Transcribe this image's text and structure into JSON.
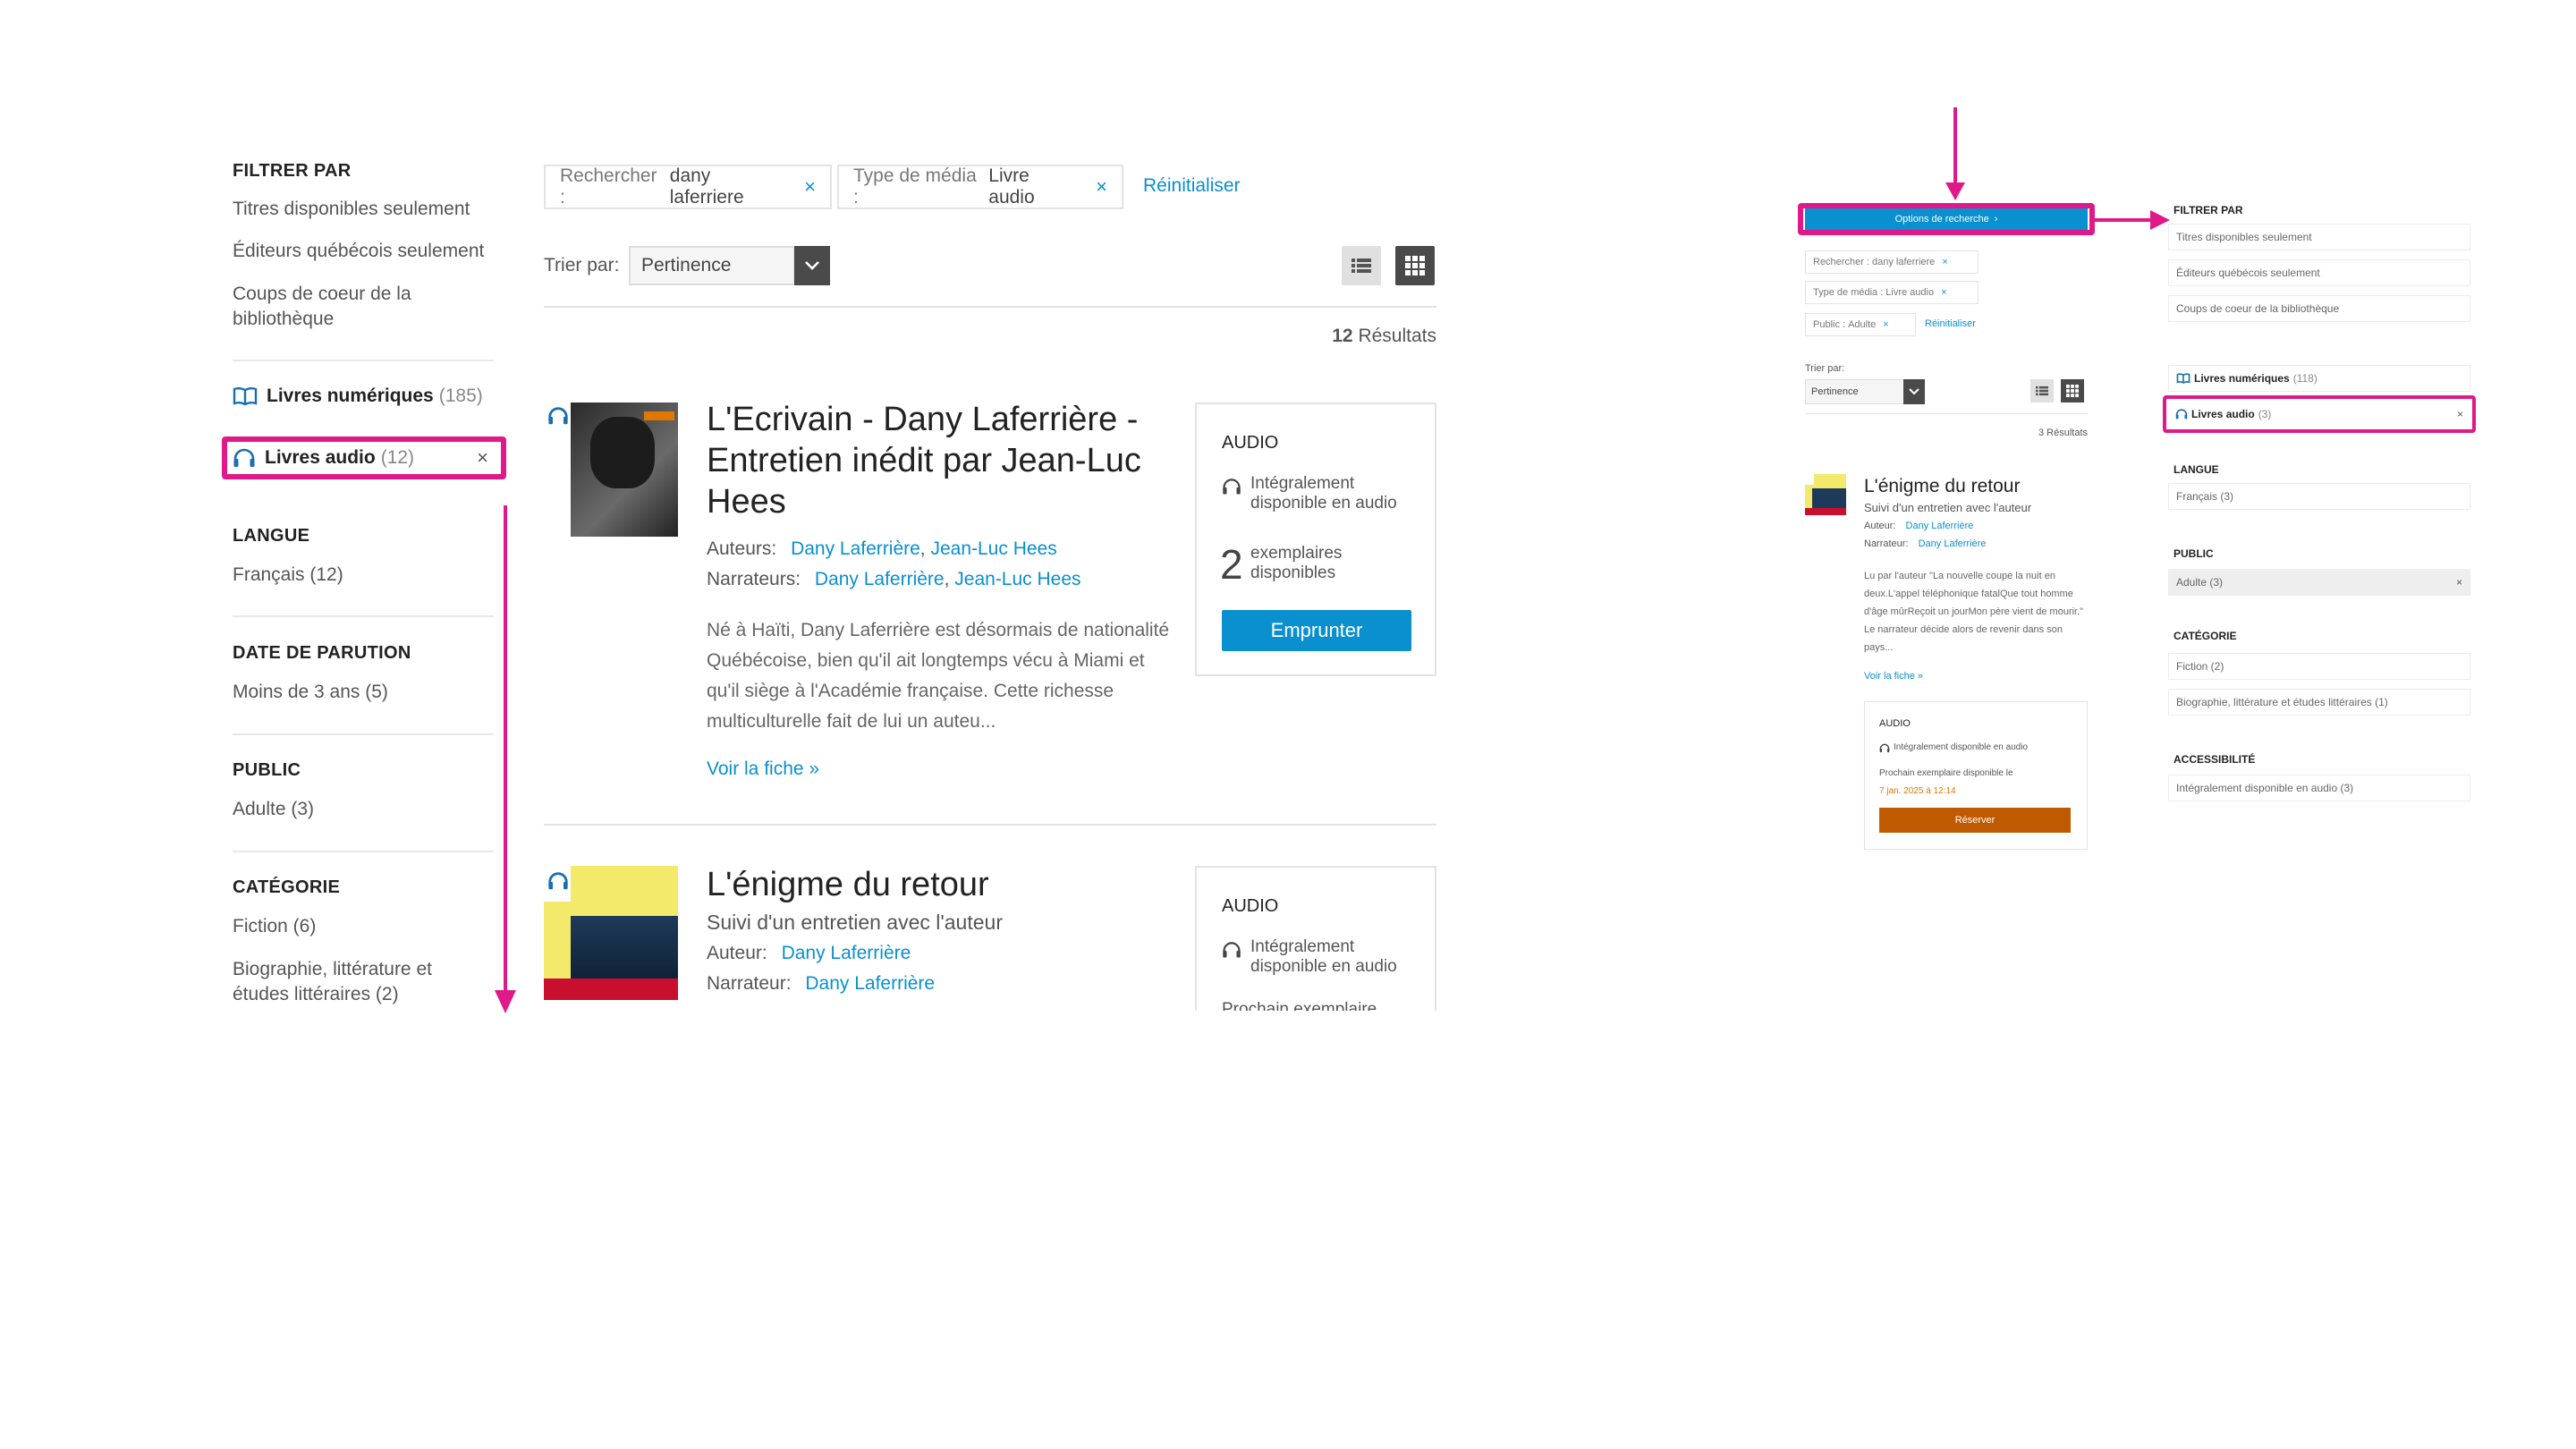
{
  "filters": {
    "heading": "FILTRER PAR",
    "quick": [
      "Titres disponibles seulement",
      "Éditeurs québécois seulement",
      "Coups de coeur de la bibliothèque"
    ],
    "media": [
      {
        "label": "Livres numériques",
        "count": "(185)",
        "icon": "open-book-icon"
      },
      {
        "label": "Livres audio",
        "count": "(12)",
        "icon": "headphones-icon",
        "remove": "×"
      }
    ],
    "langue": {
      "heading": "LANGUE",
      "items": [
        "Français (12)"
      ]
    },
    "date": {
      "heading": "DATE DE PARUTION",
      "items": [
        "Moins de 3 ans (5)"
      ]
    },
    "public": {
      "heading": "PUBLIC",
      "items": [
        "Adulte (3)"
      ]
    },
    "categorie": {
      "heading": "CATÉGORIE",
      "items": [
        "Fiction (6)",
        "Biographie, littérature et études littéraires (2)"
      ]
    }
  },
  "search": {
    "chips": [
      {
        "key": "Rechercher :",
        "value": "dany laferriere",
        "remove": "×"
      },
      {
        "key": "Type de média :",
        "value": "Livre audio",
        "remove": "×"
      }
    ],
    "reset": "Réinitialiser",
    "sort_label": "Trier par:",
    "sort_value": "Pertinence",
    "results_count": "12",
    "results_label": "Résultats"
  },
  "results": [
    {
      "title": "L'Ecrivain - Dany Laferrière - Entretien inédit par Jean-Luc Hees",
      "authors_label": "Auteurs:",
      "authors": [
        "Dany Laferrière",
        "Jean-Luc Hees"
      ],
      "narrators_label": "Narrateurs:",
      "narrators": [
        "Dany Laferrière",
        "Jean-Luc Hees"
      ],
      "description": "Né à Haïti, Dany Laferrière est désormais de nationalité Québécoise, bien qu'il ait longtemps vécu à Miami et qu'il siège à l'Académie française. Cette richesse multiculturelle fait de lui un auteu...",
      "more": "Voir la fiche »",
      "format": "AUDIO",
      "availability": "Intégralement disponible en audio",
      "copies_number": "2",
      "copies_label": "exemplaires disponibles",
      "action": "Emprunter"
    },
    {
      "title": "L'énigme du retour",
      "subtitle": "Suivi d'un entretien avec l'auteur",
      "authors_label": "Auteur:",
      "authors": [
        "Dany Laferrière"
      ],
      "narrators_label": "Narrateur:",
      "narrators": [
        "Dany Laferrière"
      ],
      "format": "AUDIO",
      "availability": "Intégralement disponible en audio",
      "next_copy": "Prochain exemplaire"
    }
  ],
  "mobile": {
    "options_button": "Options de recherche",
    "chips": [
      {
        "key": "Rechercher :",
        "value": "dany laferriere",
        "remove": "×"
      },
      {
        "key": "Type de média :",
        "value": "Livre audio",
        "remove": "×"
      },
      {
        "key": "Public :",
        "value": "Adulte",
        "remove": "×"
      }
    ],
    "reset": "Réinitialiser",
    "sort_label": "Trier par:",
    "sort_value": "Pertinence",
    "results": "3 Résultats",
    "book": {
      "title": "L'énigme du retour",
      "subtitle": "Suivi d'un entretien avec l'auteur",
      "author_label": "Auteur:",
      "author": "Dany Laferrière",
      "narrator_label": "Narrateur:",
      "narrator": "Dany Laferrière",
      "description": "Lu par l'auteur \"La nouvelle coupe la nuit en deux.L'appel téléphonique fatalQue tout homme d'âge mûrReçoit un jourMon père vient de mourir.\" Le narrateur décide alors de revenir dans son pays...",
      "more": "Voir la fiche »",
      "format": "AUDIO",
      "availability": "Intégralement disponible en audio",
      "next_label": "Prochain exemplaire disponible le",
      "next_date": "7 jan. 2025 à 12:14",
      "action": "Réserver"
    },
    "filters": {
      "heading": "FILTRER PAR",
      "quick": [
        "Titres disponibles seulement",
        "Éditeurs québécois seulement",
        "Coups de coeur de la bibliothèque"
      ],
      "media": [
        {
          "label": "Livres numériques",
          "count": "(118)"
        },
        {
          "label": "Livres audio",
          "count": "(3)",
          "remove": "×"
        }
      ],
      "langue": {
        "heading": "LANGUE",
        "item": "Français (3)"
      },
      "public": {
        "heading": "PUBLIC",
        "item": "Adulte (3)",
        "remove": "×"
      },
      "categorie": {
        "heading": "CATÉGORIE",
        "items": [
          "Fiction (2)",
          "Biographie, littérature et études littéraires (1)"
        ]
      },
      "accessibilite": {
        "heading": "ACCESSIBILITÉ",
        "item": "Intégralement disponible en audio (3)"
      }
    }
  },
  "colors": {
    "accent": "#0a8fcf",
    "highlight": "#e0198a",
    "reserve": "#c05a00",
    "date": "#e07800"
  }
}
